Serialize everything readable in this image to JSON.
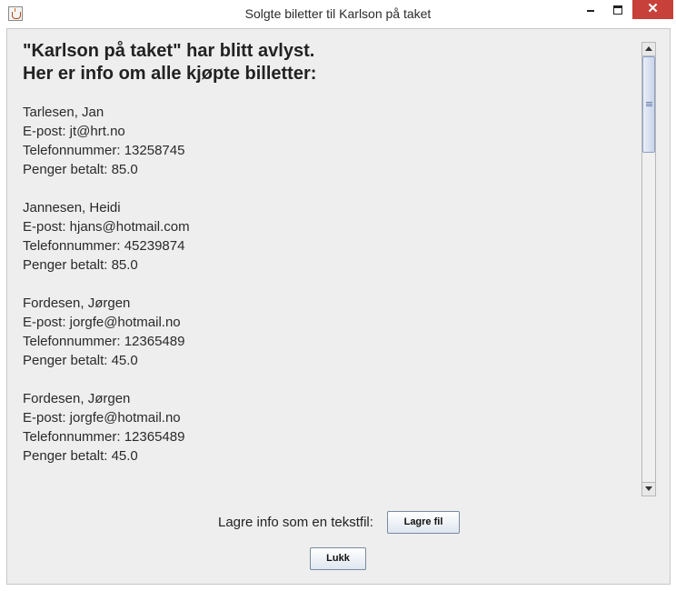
{
  "window": {
    "title": "Solgte biletter til Karlson på taket",
    "close_glyph": "✕"
  },
  "heading": {
    "line1": "\"Karlson på taket\" har blitt avlyst.",
    "line2": "Her er info om alle kjøpte billetter:"
  },
  "entries": [
    {
      "name": "Tarlesen, Jan",
      "email": "E-post: jt@hrt.no",
      "phone": "Telefonnummer: 13258745",
      "paid": "Penger betalt: 85.0"
    },
    {
      "name": "Jannesen, Heidi",
      "email": "E-post: hjans@hotmail.com",
      "phone": "Telefonnummer: 45239874",
      "paid": "Penger betalt: 85.0"
    },
    {
      "name": "Fordesen, Jørgen",
      "email": "E-post: jorgfe@hotmail.no",
      "phone": "Telefonnummer: 12365489",
      "paid": "Penger betalt: 45.0"
    },
    {
      "name": "Fordesen, Jørgen",
      "email": "E-post: jorgfe@hotmail.no",
      "phone": "Telefonnummer: 12365489",
      "paid": "Penger betalt: 45.0"
    }
  ],
  "save": {
    "label": "Lagre info som en tekstfil:",
    "button": "Lagre fil"
  },
  "close_button": "Lukk",
  "icons": {
    "app": "java-cup-icon",
    "minimize": "minimize-icon",
    "maximize": "maximize-icon",
    "close": "close-icon"
  },
  "colors": {
    "close_button_bg": "#c7403a",
    "panel_bg": "#eeeeee"
  }
}
